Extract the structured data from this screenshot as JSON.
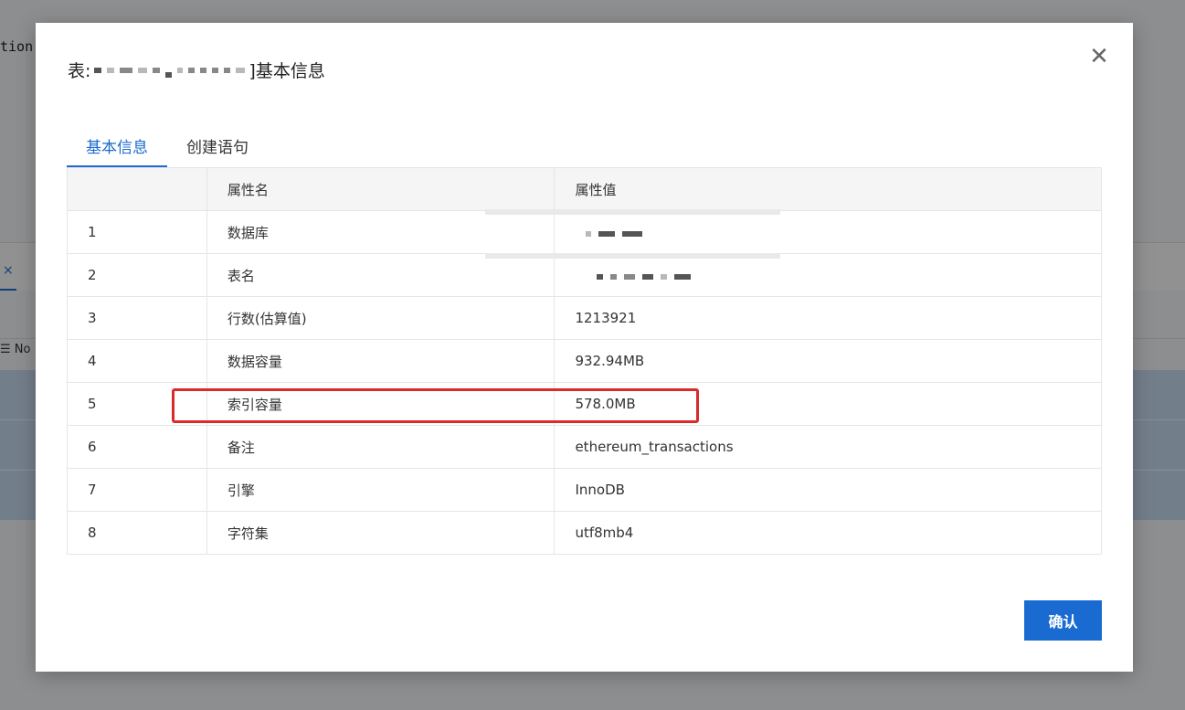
{
  "background": {
    "fragment_text": "tion",
    "tab_close": "×",
    "list_label": "☰ No"
  },
  "dialog": {
    "title_prefix": "表:",
    "title_suffix": "]基本信息",
    "close_icon": "close-icon",
    "tabs": [
      {
        "label": "基本信息",
        "active": true
      },
      {
        "label": "创建语句",
        "active": false
      }
    ],
    "table": {
      "headers": [
        "",
        "属性名",
        "属性值"
      ],
      "rows": [
        {
          "index": "1",
          "name": "数据库",
          "value": ""
        },
        {
          "index": "2",
          "name": "表名",
          "value": ""
        },
        {
          "index": "3",
          "name": "行数(估算值)",
          "value": "1213921"
        },
        {
          "index": "4",
          "name": "数据容量",
          "value": "932.94MB"
        },
        {
          "index": "5",
          "name": "索引容量",
          "value": "578.0MB"
        },
        {
          "index": "6",
          "name": "备注",
          "value": "ethereum_transactions"
        },
        {
          "index": "7",
          "name": "引擎",
          "value": "InnoDB"
        },
        {
          "index": "8",
          "name": "字符集",
          "value": "utf8mb4"
        }
      ]
    },
    "confirm_label": "确认",
    "accent_color": "#1a6bd1",
    "highlight_color": "#d92b2b"
  }
}
